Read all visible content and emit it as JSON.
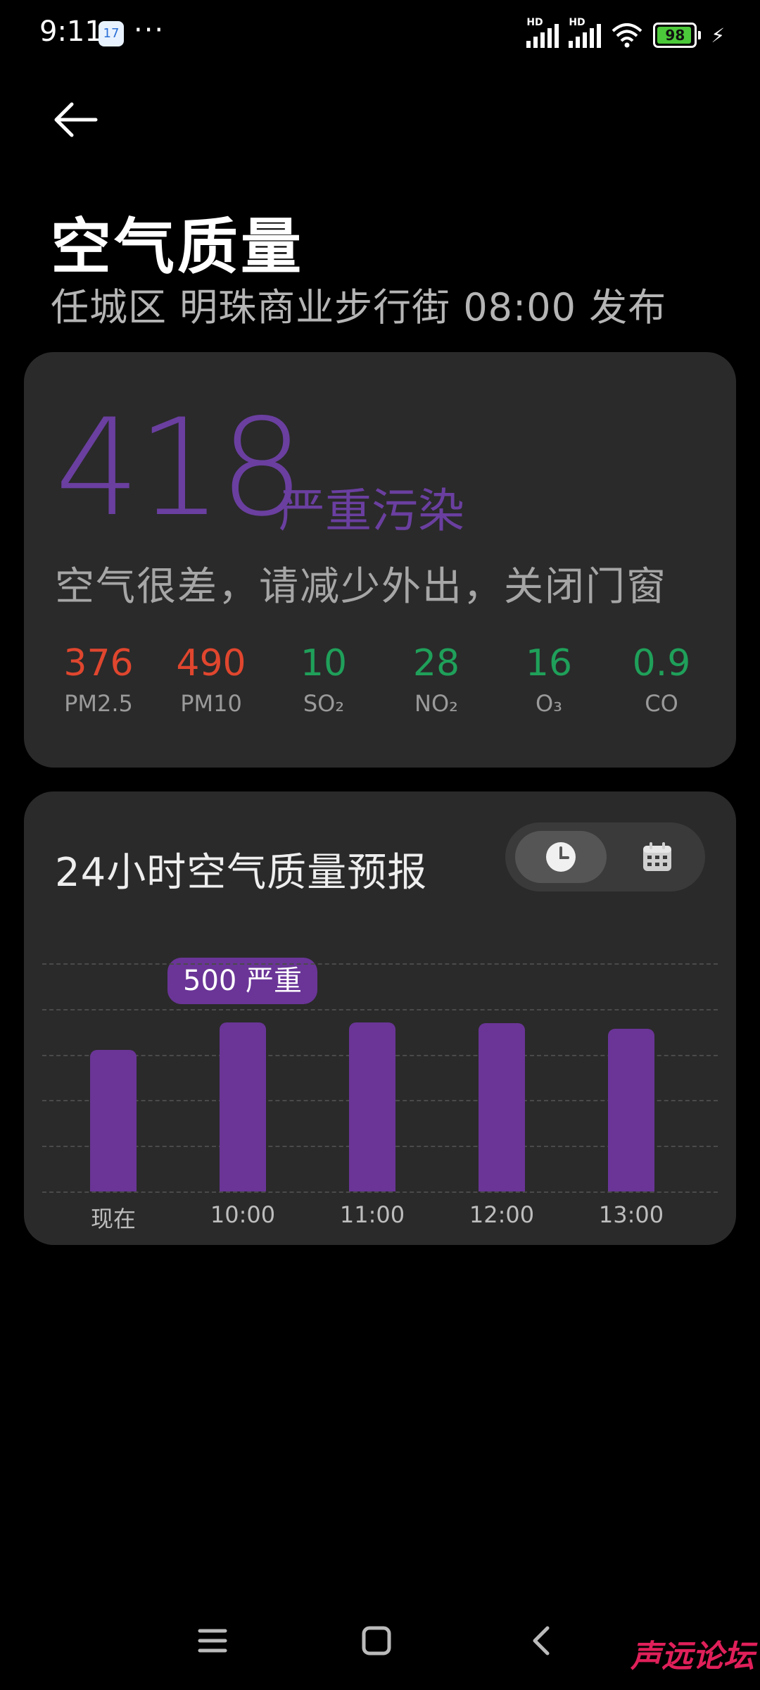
{
  "status_bar": {
    "time": "9:11",
    "app_badge": "17",
    "more": "···",
    "network1": "HD",
    "network2": "HD",
    "battery": "98"
  },
  "header": {
    "title": "空气质量",
    "subtitle": "任城区 明珠商业步行街 08:00 发布"
  },
  "aqi": {
    "value": "418",
    "level": "严重污染",
    "advice": "空气很差，请减少外出，关闭门窗",
    "accent_color": "#6a3fa0",
    "pollutants": [
      {
        "value": "376",
        "name": "PM2.5",
        "color": "#e0462e"
      },
      {
        "value": "490",
        "name": "PM10",
        "color": "#e0462e"
      },
      {
        "value": "10",
        "name": "SO₂",
        "color": "#1fa05a"
      },
      {
        "value": "28",
        "name": "NO₂",
        "color": "#1fa05a"
      },
      {
        "value": "16",
        "name": "O₃",
        "color": "#1fa05a"
      },
      {
        "value": "0.9",
        "name": "CO",
        "color": "#1fa05a"
      }
    ]
  },
  "forecast": {
    "title": "24小时空气质量预报",
    "toggle": {
      "left_icon": "clock-icon",
      "right_icon": "calendar-icon",
      "selected": "clock"
    },
    "tooltip": "500 严重",
    "bar_color": "#6a3597"
  },
  "chart_data": {
    "type": "bar",
    "categories": [
      "现在",
      "10:00",
      "11:00",
      "12:00",
      "13:00"
    ],
    "values": [
      418,
      500,
      500,
      498,
      480
    ],
    "ylim": [
      0,
      580
    ],
    "grid": true
  },
  "nav_bar": {
    "menu_icon": "menu-icon",
    "home_icon": "home-icon",
    "back_icon": "back-icon"
  },
  "watermark": "声远论坛"
}
